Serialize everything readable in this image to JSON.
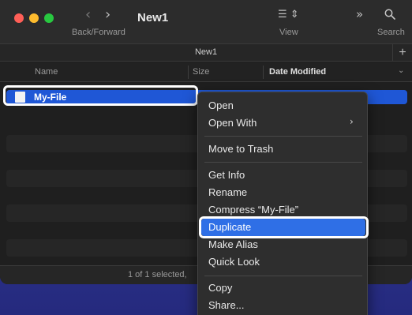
{
  "window": {
    "title": "New1",
    "back_forward_label": "Back/Forward",
    "view_label": "View",
    "search_label": "Search",
    "tab_title": "New1",
    "tab_plus": "+"
  },
  "columns": {
    "name": "Name",
    "size": "Size",
    "date_modified": "Date Modified"
  },
  "file": {
    "name": "My-File"
  },
  "status": {
    "text": "1 of 1 selected,"
  },
  "context_menu": {
    "items": [
      {
        "label": "Open"
      },
      {
        "label": "Open With"
      },
      {
        "label": "Move to Trash"
      },
      {
        "label": "Get Info"
      },
      {
        "label": "Rename"
      },
      {
        "label": "Compress “My-File”"
      },
      {
        "label": "Duplicate"
      },
      {
        "label": "Make Alias"
      },
      {
        "label": "Quick Look"
      },
      {
        "label": "Copy"
      },
      {
        "label": "Share..."
      }
    ],
    "highlighted_item": "Duplicate"
  },
  "colors": {
    "accent": "#2f6fe6",
    "selection": "#1f57d6"
  },
  "icons": [
    "chevron-left-icon",
    "chevron-right-icon",
    "list-view-icon",
    "chevron-double-right-icon",
    "search-icon",
    "file-icon",
    "chevron-right-submenu-icon"
  ]
}
